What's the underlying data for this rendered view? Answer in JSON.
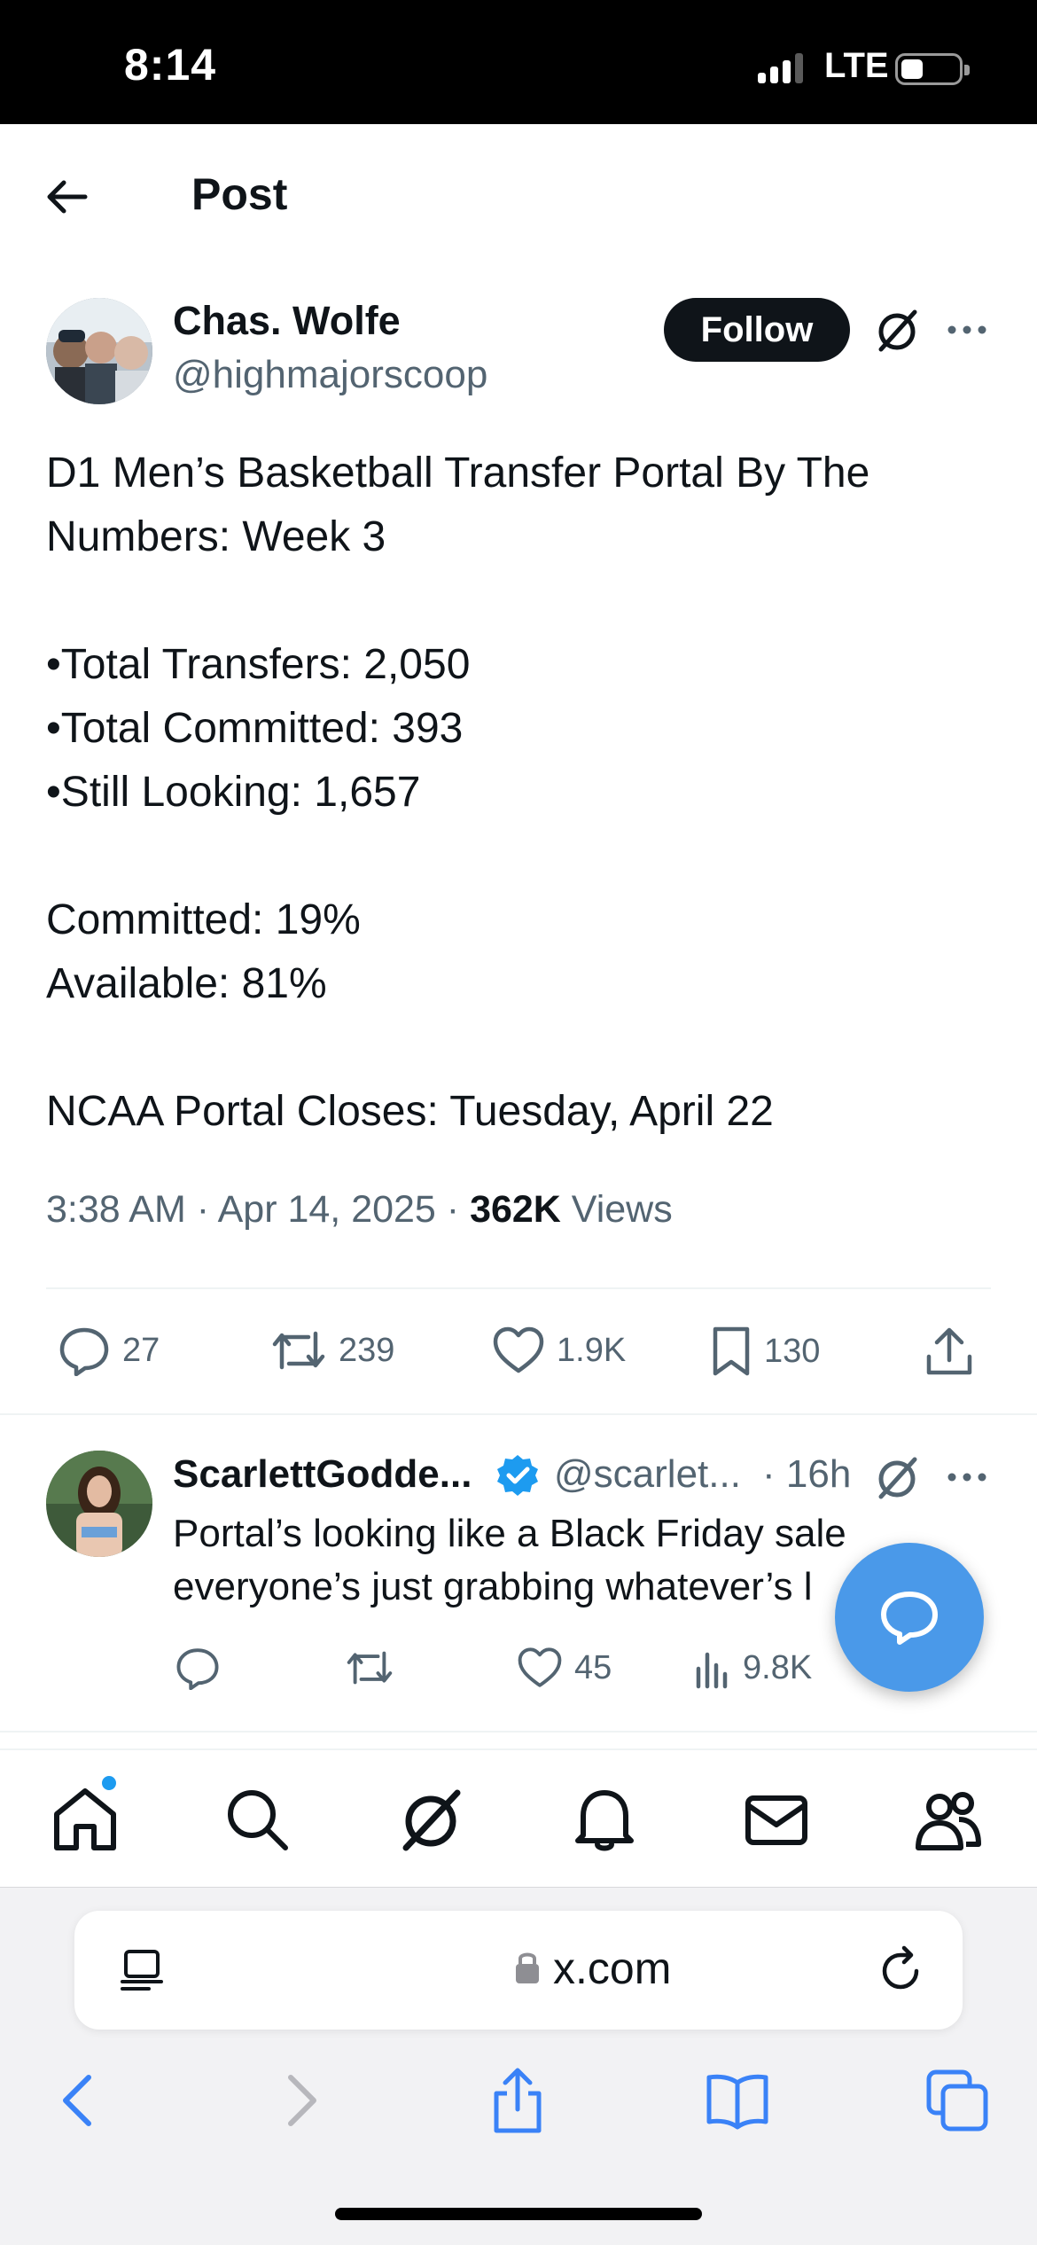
{
  "status_bar": {
    "time": "8:14",
    "network": "LTE"
  },
  "header": {
    "title": "Post"
  },
  "post": {
    "author_name": "Chas. Wolfe",
    "author_handle": "@highmajorscoop",
    "follow_label": "Follow",
    "lines": [
      "D1 Men’s Basketball Transfer Portal By The",
      "Numbers: Week 3",
      "",
      "•Total Transfers: 2,050",
      "•Total Committed: 393",
      "•Still Looking: 1,657",
      "",
      "Committed: 19%",
      "Available: 81%",
      "",
      "NCAA Portal Closes: Tuesday, April 22"
    ],
    "timestamp": "3:38 AM · Apr 14, 2025 · ",
    "views_count": "362K",
    "views_label": " Views",
    "stats": {
      "replies": "27",
      "reposts": "239",
      "likes": "1.9K",
      "bookmarks": "130"
    }
  },
  "reply": {
    "name": "ScarlettGodde...",
    "handle": "@scarlet...",
    "time": "· 16h",
    "text_line1": "Portal’s looking like a Black Friday sale",
    "text_line2": "everyone’s just grabbing whatever’s l",
    "stats": {
      "likes": "45",
      "views": "9.8K"
    }
  },
  "browser": {
    "url": "x.com"
  },
  "colors": {
    "accent": "#1d9bf0",
    "fab": "#4a99e9",
    "text": "#0f1419",
    "secondary": "#536471"
  },
  "icons": [
    "back-arrow-icon",
    "grok-icon",
    "more-icon",
    "reply-icon",
    "repost-icon",
    "like-icon",
    "bookmark-icon",
    "share-icon",
    "views-icon",
    "verified-icon",
    "chat-icon",
    "home-icon",
    "search-icon",
    "bell-icon",
    "mail-icon",
    "people-icon",
    "lock-icon",
    "reader-icon",
    "reload-icon",
    "tabs-icon"
  ]
}
